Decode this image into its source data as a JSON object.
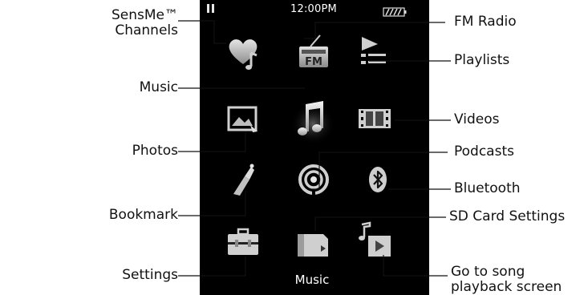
{
  "status_bar": {
    "time": "12:00PM",
    "play_state_icon": "pause-icon",
    "battery_icon": "battery-icon"
  },
  "menu_icons": [
    {
      "name": "sensme-channels-icon"
    },
    {
      "name": "fm-radio-icon",
      "glyph_text": "FM"
    },
    {
      "name": "playlists-icon"
    },
    {
      "name": "photos-icon"
    },
    {
      "name": "music-icon",
      "selected": true
    },
    {
      "name": "videos-icon"
    },
    {
      "name": "bookmark-icon"
    },
    {
      "name": "podcasts-icon"
    },
    {
      "name": "bluetooth-icon"
    },
    {
      "name": "settings-icon"
    },
    {
      "name": "sd-card-settings-icon"
    },
    {
      "name": "go-to-song-playback-icon"
    }
  ],
  "screen_label": "Music",
  "callouts": {
    "sensme": [
      "SensMe™",
      "Channels"
    ],
    "fm_radio": "FM Radio",
    "playlists": "Playlists",
    "music": "Music",
    "videos": "Videos",
    "photos": "Photos",
    "podcasts": "Podcasts",
    "bluetooth": "Bluetooth",
    "bookmark": "Bookmark",
    "sd_card_settings": "SD Card Settings",
    "settings": "Settings",
    "go_to_song": [
      "Go to song",
      "playback screen"
    ]
  },
  "colors": {
    "screen_background": "#000000",
    "icon_gray": "#c8c8c8",
    "selected_glow": "#6a6a6a"
  }
}
